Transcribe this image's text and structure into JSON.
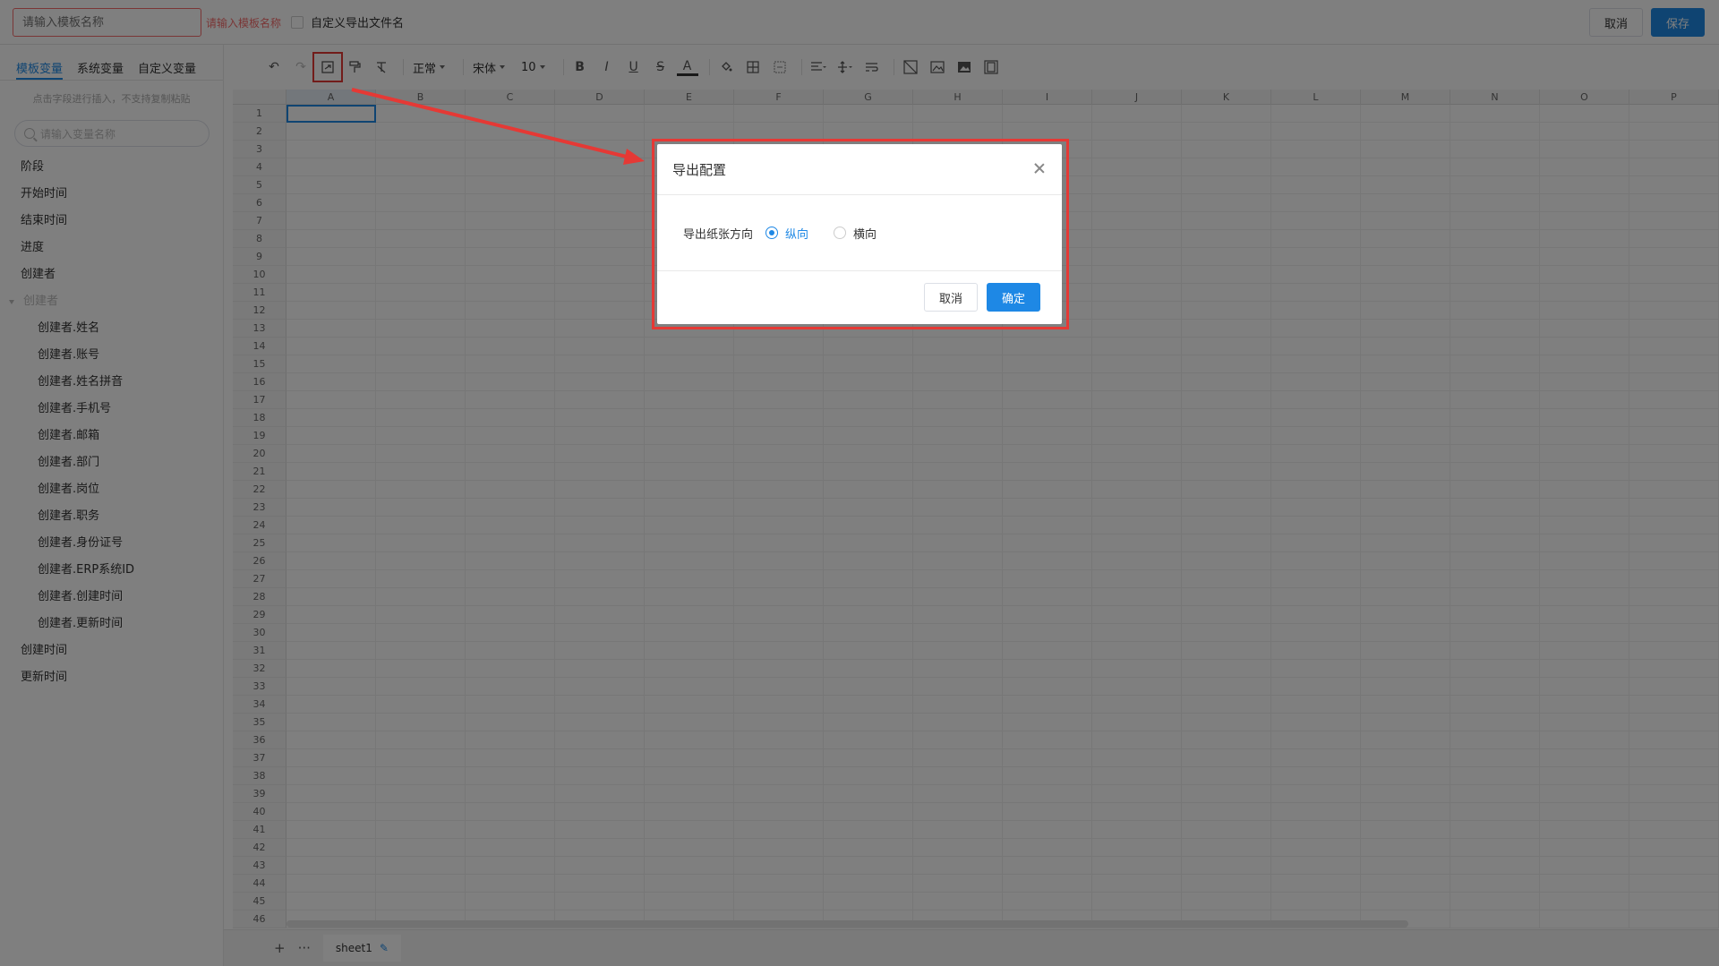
{
  "topbar": {
    "template_placeholder": "请输入模板名称",
    "template_error": "请输入模板名称",
    "custom_export_label": "自定义导出文件名",
    "cancel_label": "取消",
    "save_label": "保存"
  },
  "sidebar": {
    "tabs": [
      {
        "label": "模板变量",
        "active": true
      },
      {
        "label": "系统变量",
        "active": false
      },
      {
        "label": "自定义变量",
        "active": false
      }
    ],
    "hint": "点击字段进行插入，不支持复制粘贴",
    "search_placeholder": "请输入变量名称",
    "items": [
      {
        "label": "阶段",
        "kind": "item"
      },
      {
        "label": "开始时间",
        "kind": "item"
      },
      {
        "label": "结束时间",
        "kind": "item"
      },
      {
        "label": "进度",
        "kind": "item"
      },
      {
        "label": "创建者",
        "kind": "item"
      },
      {
        "label": "创建者",
        "kind": "group"
      },
      {
        "label": "创建者.姓名",
        "kind": "child"
      },
      {
        "label": "创建者.账号",
        "kind": "child"
      },
      {
        "label": "创建者.姓名拼音",
        "kind": "child"
      },
      {
        "label": "创建者.手机号",
        "kind": "child"
      },
      {
        "label": "创建者.邮箱",
        "kind": "child"
      },
      {
        "label": "创建者.部门",
        "kind": "child"
      },
      {
        "label": "创建者.岗位",
        "kind": "child"
      },
      {
        "label": "创建者.职务",
        "kind": "child"
      },
      {
        "label": "创建者.身份证号",
        "kind": "child"
      },
      {
        "label": "创建者.ERP系统ID",
        "kind": "child"
      },
      {
        "label": "创建者.创建时间",
        "kind": "child"
      },
      {
        "label": "创建者.更新时间",
        "kind": "child"
      },
      {
        "label": "创建时间",
        "kind": "item"
      },
      {
        "label": "更新时间",
        "kind": "item"
      }
    ]
  },
  "toolbar": {
    "format_select": "正常",
    "font_select": "宋体",
    "size_select": "10"
  },
  "grid": {
    "columns": [
      "A",
      "B",
      "C",
      "D",
      "E",
      "F",
      "G",
      "H",
      "I",
      "J",
      "K",
      "L",
      "M",
      "N",
      "O",
      "P"
    ],
    "row_count": 46,
    "active_cell": "A1"
  },
  "sheetbar": {
    "add_label": "+",
    "more_label": "···",
    "sheet_name": "sheet1"
  },
  "modal": {
    "title": "导出配置",
    "field_label": "导出纸张方向",
    "options": [
      {
        "label": "纵向",
        "checked": true
      },
      {
        "label": "横向",
        "checked": false
      }
    ],
    "cancel_label": "取消",
    "ok_label": "确定"
  },
  "colors": {
    "accent": "#1e88e5",
    "error": "#f56c6c",
    "annotation": "#e53935"
  }
}
